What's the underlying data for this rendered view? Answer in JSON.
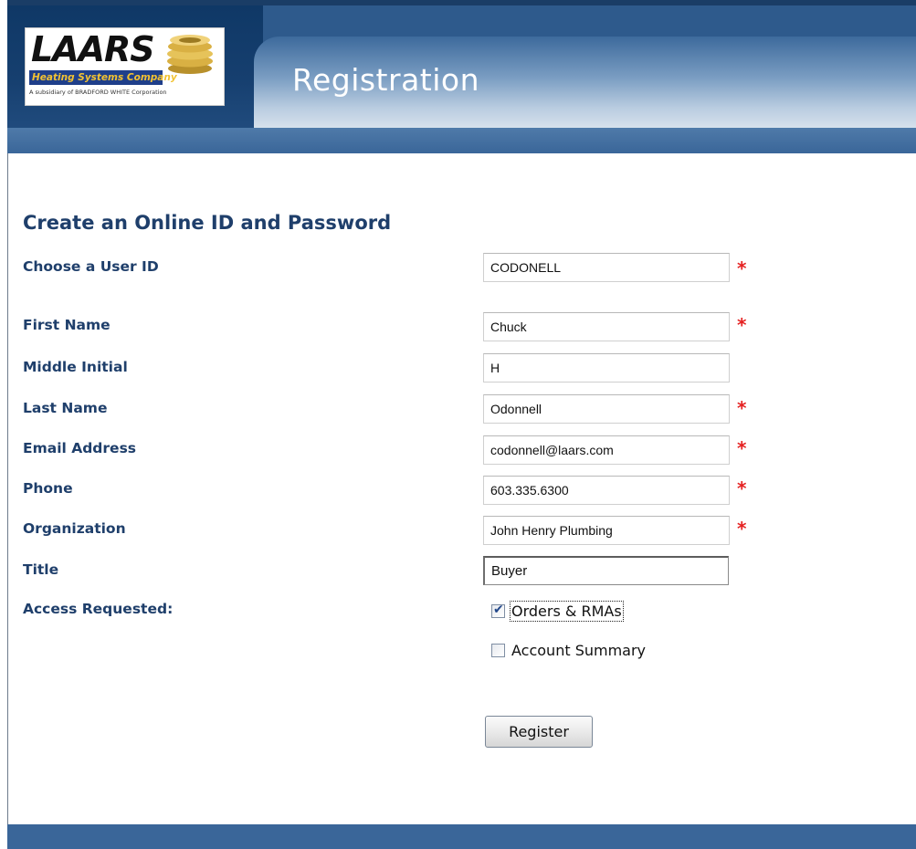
{
  "header": {
    "logo": {
      "brand": "LAARS",
      "tagline": "Heating Systems Company",
      "subsidiary": "A subsidiary of BRADFORD WHITE Corporation"
    },
    "title": "Registration"
  },
  "form": {
    "heading": "Create an Online ID and Password",
    "required_marker": "*",
    "fields": {
      "user_id": {
        "label": "Choose a User ID",
        "value": "CODONELL",
        "required": true
      },
      "first_name": {
        "label": "First Name",
        "value": "Chuck",
        "required": true
      },
      "middle_initial": {
        "label": "Middle Initial",
        "value": "H",
        "required": false
      },
      "last_name": {
        "label": "Last Name",
        "value": "Odonnell",
        "required": true
      },
      "email": {
        "label": "Email Address",
        "value": "codonnell@laars.com",
        "required": true
      },
      "phone": {
        "label": "Phone",
        "value": "603.335.6300",
        "required": true
      },
      "organization": {
        "label": "Organization",
        "value": "John Henry Plumbing",
        "required": true
      },
      "title": {
        "label": "Title",
        "value": "Buyer",
        "required": false
      }
    },
    "access": {
      "label": "Access Requested:",
      "options": [
        {
          "label": "Orders & RMAs",
          "checked": true
        },
        {
          "label": "Account Summary",
          "checked": false
        }
      ]
    },
    "submit_label": "Register"
  },
  "colors": {
    "header_dark": "#163f6f",
    "header_band": "#3a6699",
    "label_text": "#1f3f6b",
    "required": "#e52222"
  }
}
